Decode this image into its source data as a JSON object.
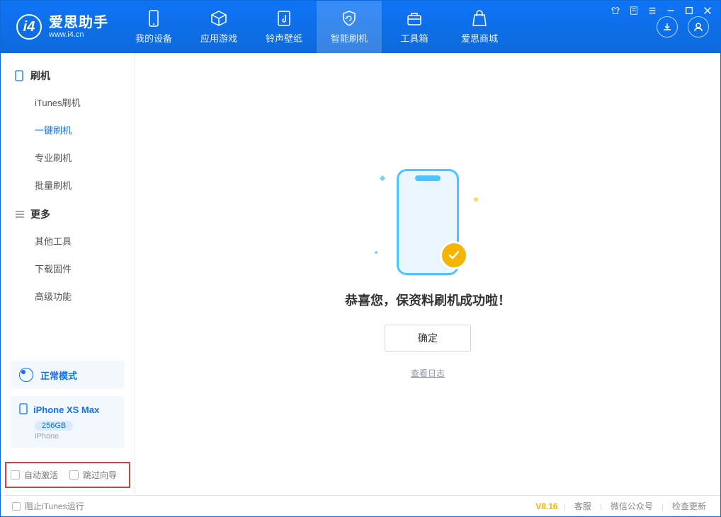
{
  "brand": {
    "title": "爱思助手",
    "subtitle": "www.i4.cn",
    "logo_letter": "i4"
  },
  "nav": {
    "items": [
      {
        "label": "我的设备"
      },
      {
        "label": "应用游戏"
      },
      {
        "label": "铃声壁纸"
      },
      {
        "label": "智能刷机"
      },
      {
        "label": "工具箱"
      },
      {
        "label": "爱思商城"
      }
    ],
    "active_index": 3
  },
  "sidebar": {
    "groups": [
      {
        "title": "刷机",
        "icon": "phone-icon",
        "items": [
          {
            "label": "iTunes刷机"
          },
          {
            "label": "一键刷机"
          },
          {
            "label": "专业刷机"
          },
          {
            "label": "批量刷机"
          }
        ],
        "active_index": 1
      },
      {
        "title": "更多",
        "icon": "menu-icon",
        "items": [
          {
            "label": "其他工具"
          },
          {
            "label": "下载固件"
          },
          {
            "label": "高级功能"
          }
        ],
        "active_index": -1
      }
    ],
    "mode_label": "正常模式",
    "device": {
      "name": "iPhone XS Max",
      "storage": "256GB",
      "sub": "iPhone"
    },
    "checkboxes": {
      "auto_activate": "自动激活",
      "skip_guide": "跳过向导"
    }
  },
  "content": {
    "success_message": "恭喜您，保资料刷机成功啦！",
    "ok_button": "确定",
    "view_log": "查看日志"
  },
  "statusbar": {
    "block_itunes": "阻止iTunes运行",
    "version": "V8.16",
    "links": [
      "客服",
      "微信公众号",
      "检查更新"
    ]
  }
}
